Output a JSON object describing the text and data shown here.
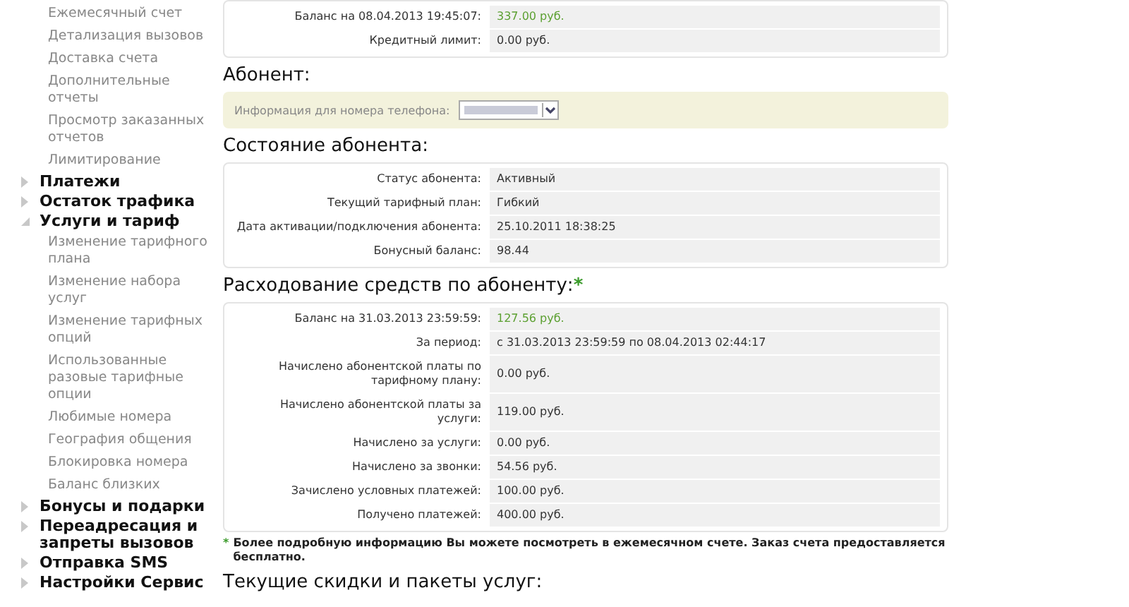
{
  "sidebar": {
    "items": [
      {
        "kind": "link",
        "label": "Ежемесячный счет"
      },
      {
        "kind": "link",
        "label": "Детализация вызовов"
      },
      {
        "kind": "link",
        "label": "Доставка счета"
      },
      {
        "kind": "link",
        "label": "Дополнительные отчеты"
      },
      {
        "kind": "link",
        "label": "Просмотр заказанных отчетов"
      },
      {
        "kind": "link",
        "label": "Лимитирование"
      },
      {
        "kind": "group",
        "label": "Платежи",
        "expanded": false
      },
      {
        "kind": "group",
        "label": "Остаток трафика",
        "expanded": false
      },
      {
        "kind": "group",
        "label": "Услуги и тариф",
        "expanded": true,
        "children": [
          {
            "label": "Изменение тарифного плана"
          },
          {
            "label": "Изменение набора услуг"
          },
          {
            "label": "Изменение тарифных опций"
          },
          {
            "label": "Использованные разовые тарифные опции"
          },
          {
            "label": "Любимые номера"
          },
          {
            "label": "География общения"
          },
          {
            "label": "Блокировка номера"
          },
          {
            "label": "Баланс близких"
          }
        ]
      },
      {
        "kind": "group",
        "label": "Бонусы и подарки",
        "expanded": false
      },
      {
        "kind": "group",
        "label": "Переадресация и запреты вызовов",
        "expanded": false
      },
      {
        "kind": "group",
        "label": "Отправка SMS",
        "expanded": false
      },
      {
        "kind": "group",
        "label": "Настройки Сервис",
        "expanded": false
      }
    ]
  },
  "sections": [
    {
      "kind": "table",
      "rows": [
        {
          "label": "Баланс на 08.04.2013 19:45:07:",
          "value": "337.00 руб.",
          "highlight": true
        },
        {
          "label": "Кредитный лимит:",
          "value": "0.00 руб.",
          "highlight": false
        }
      ]
    },
    {
      "kind": "heading",
      "title": "Абонент:"
    },
    {
      "kind": "phone",
      "label": "Информация для номера телефона:"
    },
    {
      "kind": "heading",
      "title": "Состояние абонента:"
    },
    {
      "kind": "table",
      "rows": [
        {
          "label": "Статус абонента:",
          "value": "Активный",
          "highlight": false
        },
        {
          "label": "Текущий тарифный план:",
          "value": "Гибкий",
          "highlight": false
        },
        {
          "label": "Дата активации/подключения абонента:",
          "value": "25.10.2011 18:38:25",
          "highlight": false
        },
        {
          "label": "Бонусный баланс:",
          "value": "98.44",
          "highlight": false
        }
      ]
    },
    {
      "kind": "heading",
      "title": "Расходование средств по абоненту:",
      "marker": "*"
    },
    {
      "kind": "table",
      "rows": [
        {
          "label": "Баланс на 31.03.2013 23:59:59:",
          "value": "127.56 руб.",
          "highlight": true
        },
        {
          "label": "За период:",
          "value": "с 31.03.2013 23:59:59 по 08.04.2013 02:44:17",
          "highlight": false
        },
        {
          "label": "Начислено абонентской платы по тарифному плану:",
          "value": "0.00 руб.",
          "highlight": false
        },
        {
          "label": "Начислено абонентской платы за услуги:",
          "value": "119.00 руб.",
          "highlight": false
        },
        {
          "label": "Начислено за услуги:",
          "value": "0.00 руб.",
          "highlight": false
        },
        {
          "label": "Начислено за звонки:",
          "value": "54.56 руб.",
          "highlight": false
        },
        {
          "label": "Зачислено условных платежей:",
          "value": "100.00 руб.",
          "highlight": false
        },
        {
          "label": "Получено платежей:",
          "value": "400.00 руб.",
          "highlight": false
        }
      ]
    },
    {
      "kind": "note",
      "marker": "*",
      "text": "Более подробную информацию Вы можете посмотреть в ежемесячном счете. Заказ счета предоставляется бесплатно."
    },
    {
      "kind": "heading",
      "title": "Текущие скидки и пакеты услуг:"
    }
  ]
}
